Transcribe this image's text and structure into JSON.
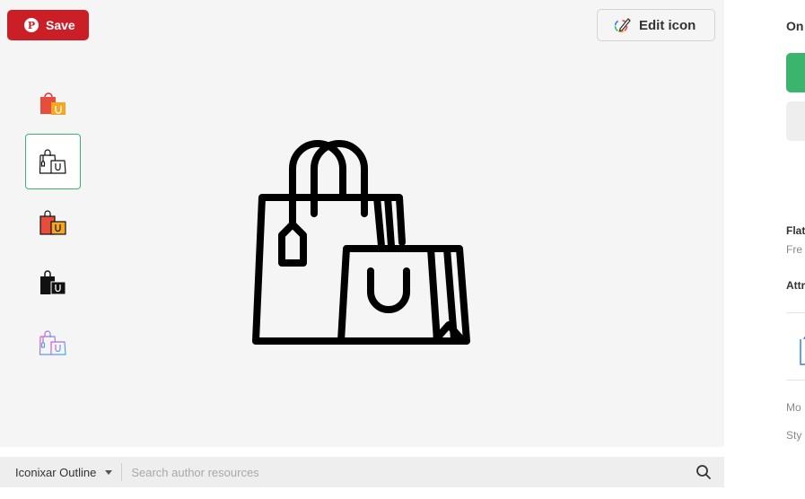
{
  "save_button": {
    "label": "Save",
    "pin_glyph": "P"
  },
  "edit_button": {
    "label": "Edit icon"
  },
  "variants": [
    {
      "name": "flat-color",
      "selected": false
    },
    {
      "name": "outline",
      "selected": true
    },
    {
      "name": "lineal-color",
      "selected": false
    },
    {
      "name": "glyph",
      "selected": false
    },
    {
      "name": "gradient-outline",
      "selected": false
    }
  ],
  "search": {
    "author_label": "Iconixar Outline",
    "placeholder": "Search author resources"
  },
  "side_panel": {
    "heading": "On",
    "flat_label": "Flat",
    "free_label": "Fre",
    "attr_label": "Attr",
    "more_label": "Mo",
    "style_label": "Sty"
  },
  "colors": {
    "save_red": "#cb1f27",
    "accent_green": "#3bb46e",
    "preview_bg": "#f5f5f5"
  }
}
